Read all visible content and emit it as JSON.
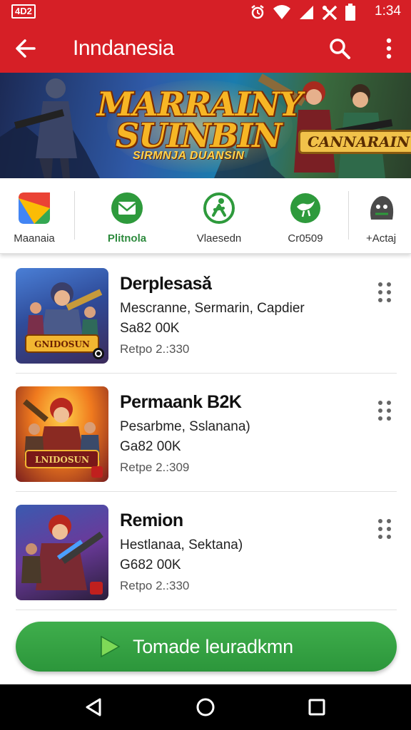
{
  "status_bar": {
    "badge": "4D2",
    "time": "1:34",
    "icons": [
      "alarm-icon",
      "wifi-icon",
      "signal-icon",
      "tools-icon",
      "battery-icon"
    ]
  },
  "app_bar": {
    "title": "Inndanesia",
    "icons": [
      "back-arrow-icon",
      "search-icon",
      "more-vert-icon"
    ]
  },
  "banner": {
    "title_line1": "MARRAINY",
    "title_line2": "SUINBIN",
    "subtitle": "SIRMNJA DUANSIN",
    "tag": "CANNARAIN"
  },
  "categories": [
    {
      "label": "Maanaia",
      "icon": "colorful-square-icon"
    },
    {
      "label": "Plitnola",
      "icon": "green-envelope-icon"
    },
    {
      "label": "Vlaesedn",
      "icon": "green-figure-icon"
    },
    {
      "label": "Cr0509",
      "icon": "green-bird-icon"
    },
    {
      "label": "+Actaj",
      "icon": "dark-creature-icon"
    }
  ],
  "apps": [
    {
      "title": "Derplesasǎ",
      "description": "Mescranne, Sermarin, Capdier",
      "size": "Sa82 00K",
      "version": "Retpo 2.:330",
      "thumb_label": "GNIDOSUN"
    },
    {
      "title": "Permaank B2K",
      "description": "Pesarbme, Sslanana)",
      "size": "Ga82 00K",
      "version": "Retpe 2.:309",
      "thumb_label": "LNIDOSUN"
    },
    {
      "title": "Remion",
      "description": "Hestlanaa, Sektana)",
      "size": "G682 00K",
      "version": "Retpo 2.:330",
      "thumb_label": ""
    }
  ],
  "cta": {
    "label": "Tomade leuradkmn"
  },
  "nav_bar": {
    "icons": [
      "back-triangle-icon",
      "home-circle-icon",
      "recents-square-icon"
    ]
  },
  "colors": {
    "brand_red": "#d61f26",
    "accent_green": "#2e9a3c",
    "nav_black": "#000000"
  }
}
